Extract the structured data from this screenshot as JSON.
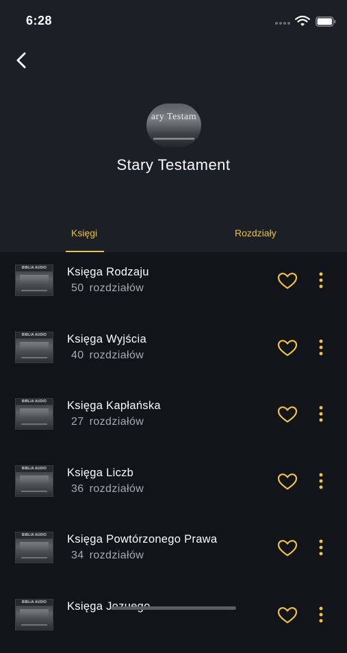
{
  "status_bar": {
    "time": "6:28",
    "icons": [
      "signal-dots-icon",
      "wifi-icon",
      "battery-icon"
    ]
  },
  "header": {
    "back_icon": "chevron-left-icon",
    "cover_text": "ary Testam",
    "title": "Stary Testament"
  },
  "tabs": [
    {
      "label": "Księgi",
      "selected": true
    },
    {
      "label": "Rozdziały",
      "selected": false
    }
  ],
  "thumbnail_text": "BIBLIA AUDIO",
  "books": [
    {
      "title": "Księga Rodzaju",
      "count": "50",
      "unit": "rozdziałów"
    },
    {
      "title": "Księga Wyjścia",
      "count": "40",
      "unit": "rozdziałów"
    },
    {
      "title": "Księga Kapłańska",
      "count": "27",
      "unit": "rozdziałów"
    },
    {
      "title": "Księga Liczb",
      "count": "36",
      "unit": "rozdziałów"
    },
    {
      "title": "Księga Powtórzonego Prawa",
      "count": "34",
      "unit": "rozdziałów"
    },
    {
      "title": "Księga Jozuego",
      "count": "",
      "unit": ""
    }
  ],
  "colors": {
    "accent": "#f3c33d",
    "background": "#111419",
    "header_background": "#1b1f26",
    "secondary_text": "#a7abb1"
  }
}
